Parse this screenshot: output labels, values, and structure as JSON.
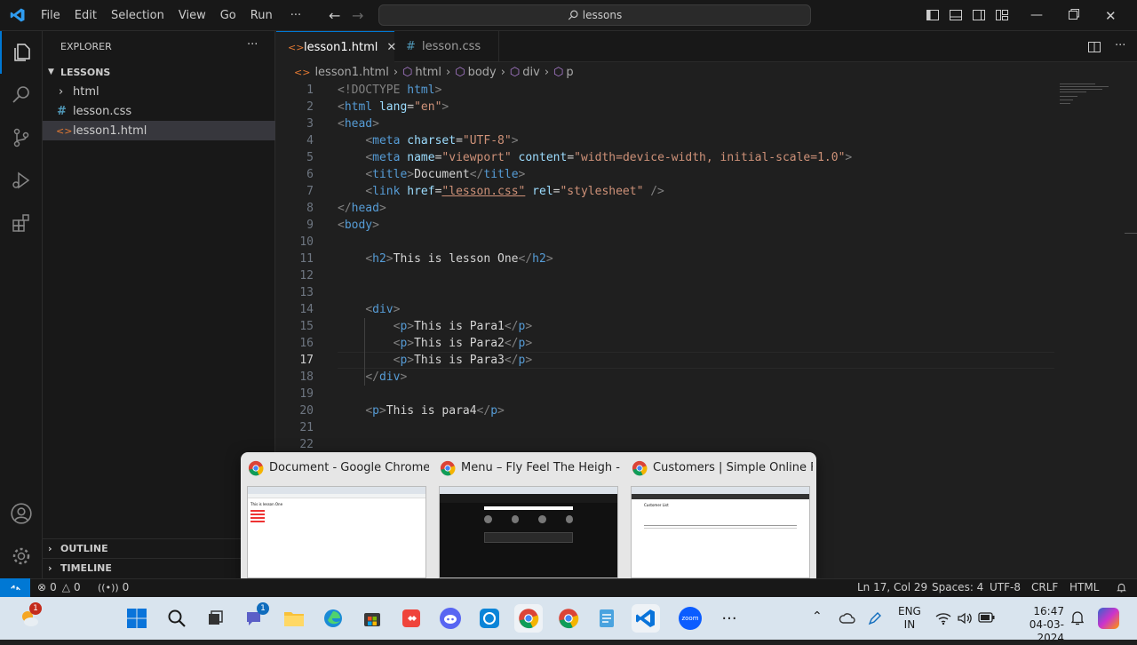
{
  "titlebar": {
    "menu": [
      "File",
      "Edit",
      "Selection",
      "View",
      "Go",
      "Run",
      "···"
    ],
    "search_text": "lessons"
  },
  "sidebar": {
    "title": "EXPLORER",
    "more": "···",
    "folder": "LESSONS",
    "items": [
      {
        "label": "html",
        "type": "folder"
      },
      {
        "label": "lesson.css",
        "type": "css"
      },
      {
        "label": "lesson1.html",
        "type": "html"
      }
    ],
    "outline": "OUTLINE",
    "timeline": "TIMELINE"
  },
  "tabs": [
    {
      "label": "lesson1.html",
      "active": true
    },
    {
      "label": "lesson.css",
      "active": false
    }
  ],
  "breadcrumb": [
    "lesson1.html",
    "html",
    "body",
    "div",
    "p"
  ],
  "editor": {
    "line_numbers": [
      "1",
      "2",
      "3",
      "4",
      "5",
      "6",
      "7",
      "8",
      "9",
      "10",
      "11",
      "12",
      "13",
      "14",
      "15",
      "16",
      "17",
      "18",
      "19",
      "20",
      "21",
      "22"
    ],
    "code": {
      "l1_doctype": "<!DOCTYPE",
      "l1_html": "html",
      "l2_tag": "html",
      "l2_attr": "lang",
      "l2_val": "\"en\"",
      "l3_tag": "head",
      "l4_tag": "meta",
      "l4_attr": "charset",
      "l4_val": "\"UTF-8\"",
      "l5_tag": "meta",
      "l5_attr1": "name",
      "l5_val1": "\"viewport\"",
      "l5_attr2": "content",
      "l5_val2": "\"width=device-width, initial-scale=1.0\"",
      "l6_tag": "title",
      "l6_text": "Document",
      "l7_tag": "link",
      "l7_attr1": "href",
      "l7_val1": "\"lesson.css\"",
      "l7_attr2": "rel",
      "l7_val2": "\"stylesheet\"",
      "l8_tag": "head",
      "l9_tag": "body",
      "l11_tag": "h2",
      "l11_text": "This is lesson One",
      "l14_tag": "div",
      "l15_text": "This is Para1",
      "l16_text": "This is Para2",
      "l17_text": "This is Para3",
      "l18_tag": "div",
      "l20_text": "This is para4",
      "p_tag": "p"
    }
  },
  "preview": {
    "windows": [
      {
        "title": "Document - Google Chrome",
        "thumb_heading": "This is lesson One"
      },
      {
        "title": "Menu – Fly Feel The Heigh - Go..."
      },
      {
        "title": "Customers | Simple Online Foo...",
        "thumb_heading": "Customer List"
      }
    ]
  },
  "statusbar": {
    "errors": "0",
    "warnings": "0",
    "ports": "0",
    "position": "Ln 17, Col 29",
    "spaces": "Spaces: 4",
    "encoding": "UTF-8",
    "eol": "CRLF",
    "language": "HTML"
  },
  "taskbar": {
    "weather_badge": "1",
    "teams_badge": "1",
    "lang1": "ENG",
    "lang2": "IN",
    "time": "16:47",
    "date": "04-03-2024",
    "zoom_label": "zoom"
  },
  "colors": {
    "accent": "#0078d4",
    "tag": "#569cd6",
    "attr": "#9cdcfe",
    "string": "#ce9178"
  }
}
